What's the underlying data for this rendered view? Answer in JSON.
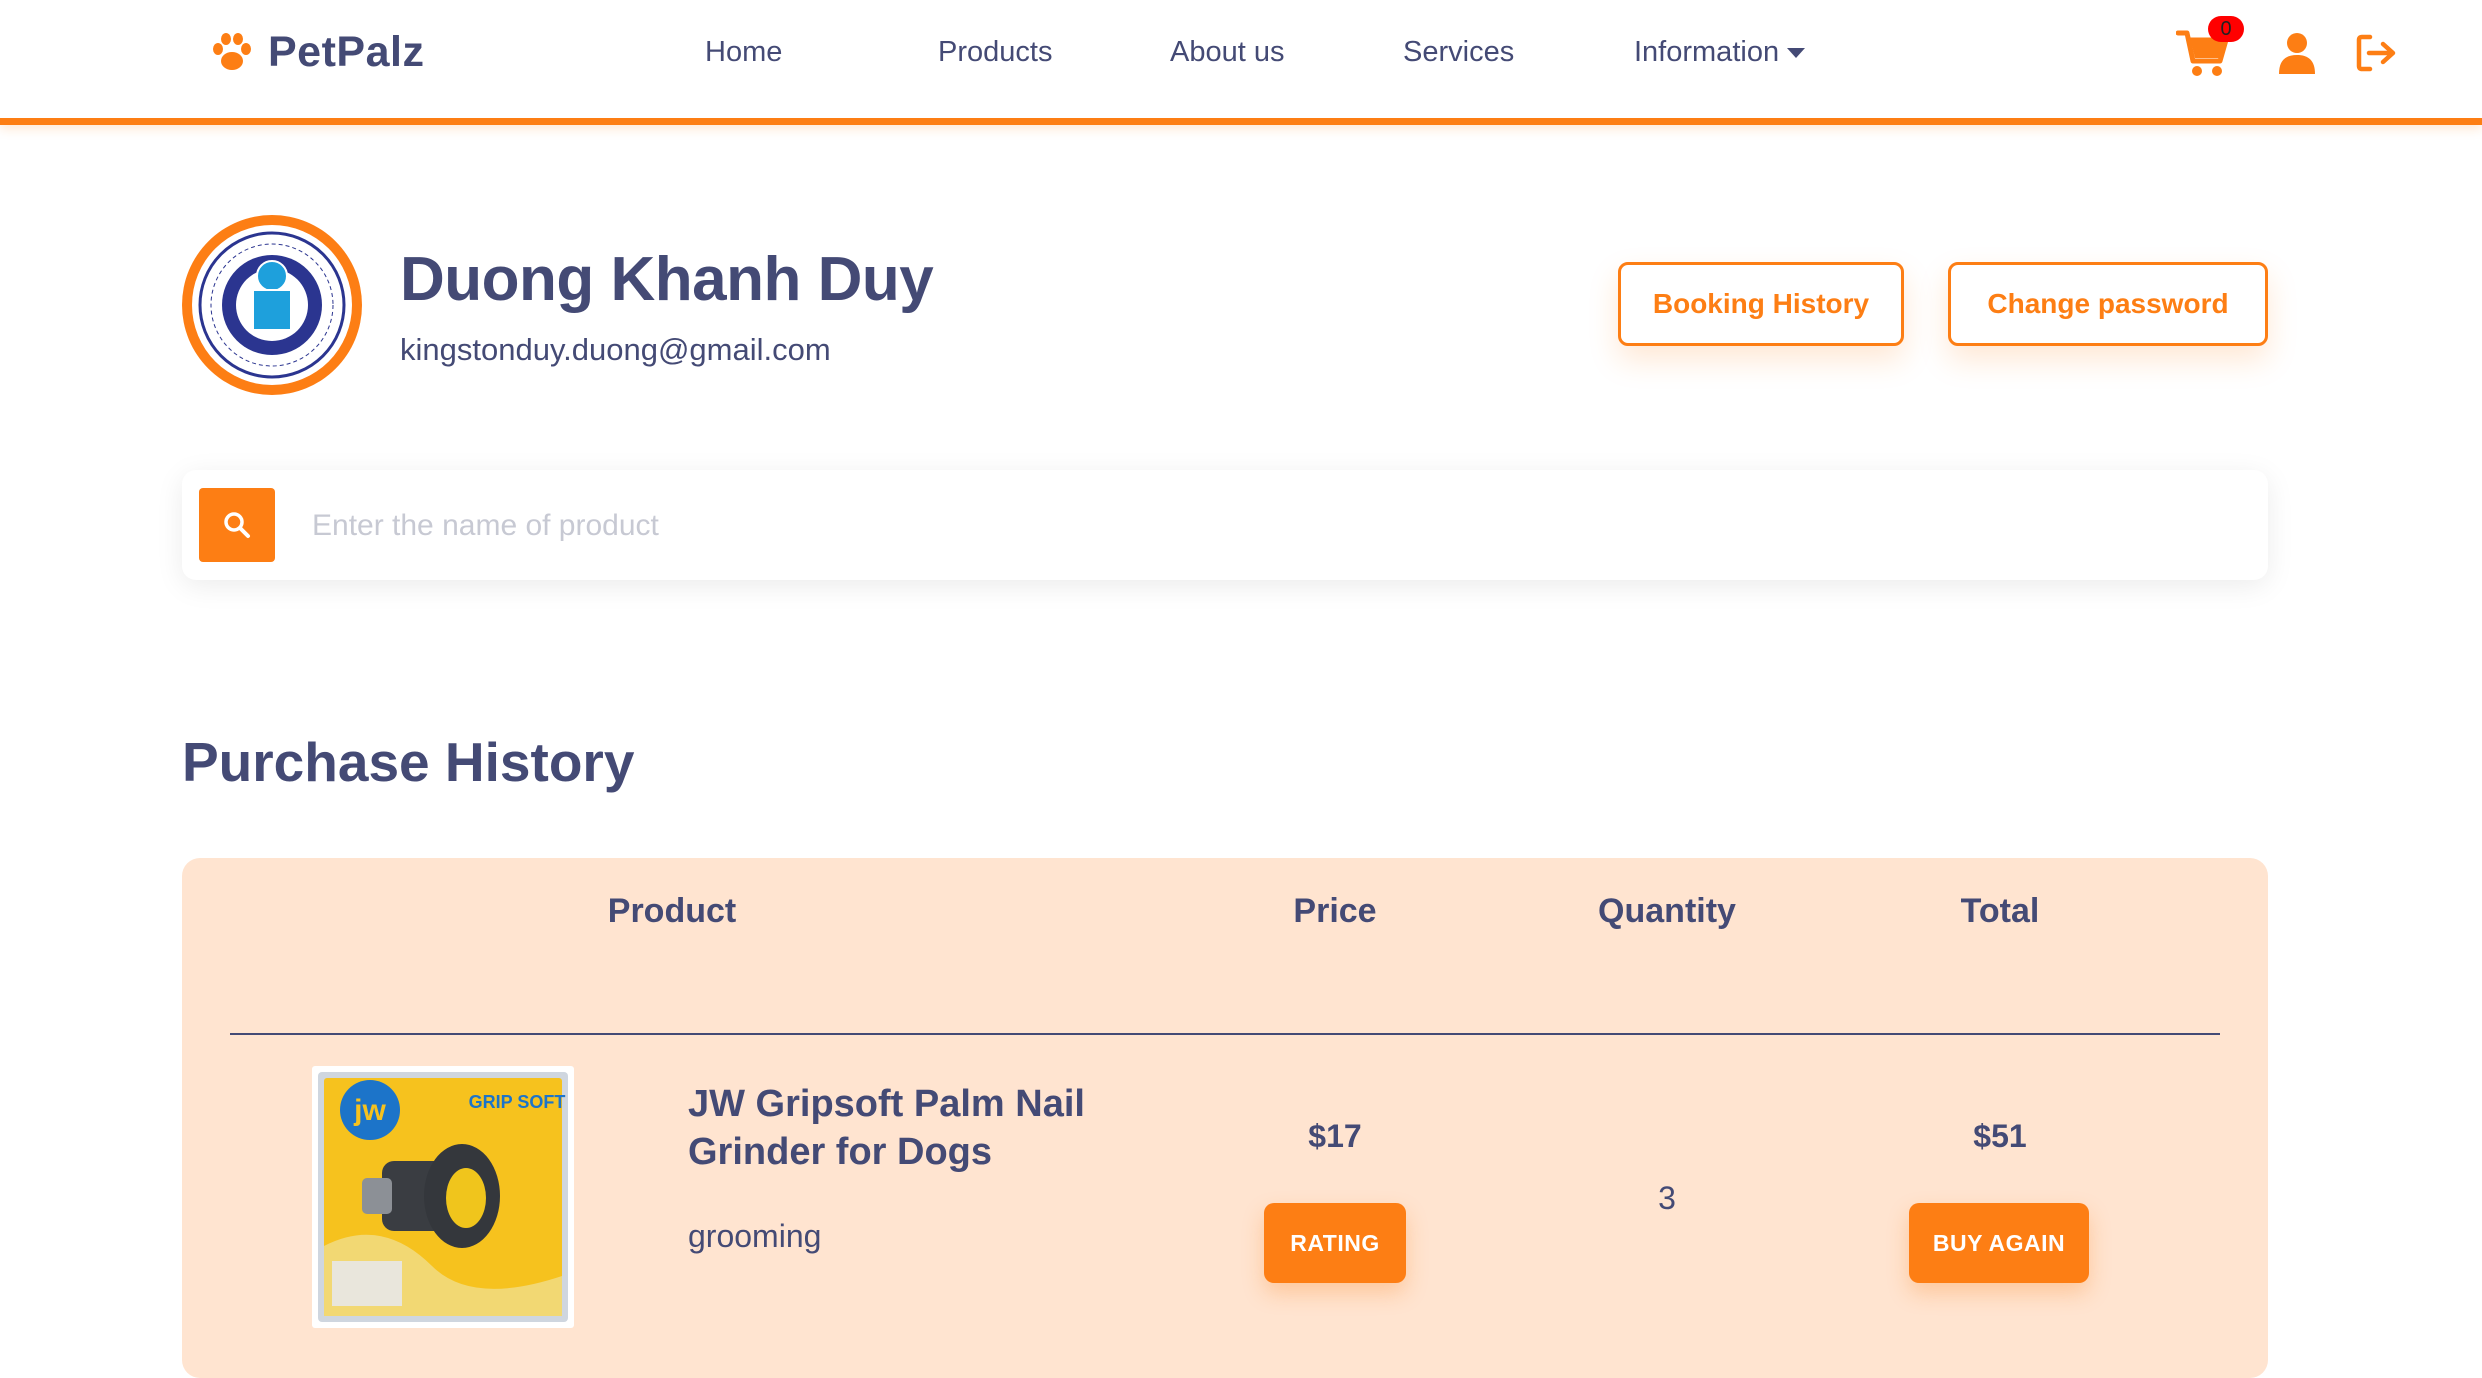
{
  "header": {
    "brand": "PetPalz",
    "nav": {
      "home": "Home",
      "products": "Products",
      "about": "About us",
      "services": "Services",
      "information": "Information"
    },
    "cart_count": "0"
  },
  "profile": {
    "name": "Duong Khanh Duy",
    "email": "kingstonduy.duong@gmail.com",
    "booking_history_label": "Booking History",
    "change_password_label": "Change password"
  },
  "search": {
    "placeholder": "Enter the name of product"
  },
  "purchase_history": {
    "title": "Purchase History",
    "columns": {
      "product": "Product",
      "price": "Price",
      "quantity": "Quantity",
      "total": "Total"
    },
    "rows": [
      {
        "name": "JW Gripsoft Palm Nail Grinder for Dogs",
        "category": "grooming",
        "price": "$17",
        "quantity": "3",
        "total": "$51",
        "rating_label": "RATING",
        "buy_again_label": "BUY AGAIN",
        "image_brand": "jw",
        "image_label": "GRIP SOFT"
      }
    ]
  },
  "colors": {
    "accent": "#fd7e14",
    "text": "#444a75",
    "table_bg": "#ffe4d0",
    "badge": "#ff0000"
  }
}
